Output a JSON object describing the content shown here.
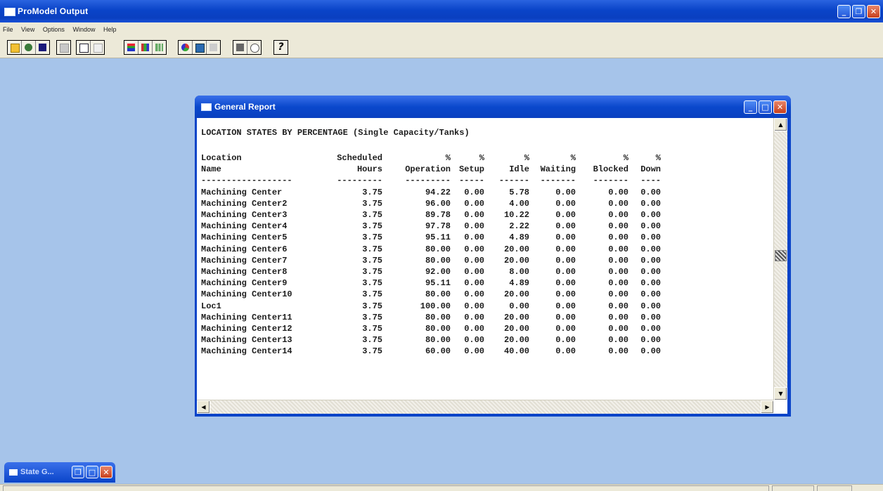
{
  "app": {
    "title": "ProModel Output"
  },
  "menu": [
    "File",
    "View",
    "Options",
    "Window",
    "Help"
  ],
  "toolbar": {
    "groups": [
      [
        "open-icon",
        "swap-icon",
        "save-icon"
      ],
      [
        "disabled-icon"
      ],
      [
        "report-icon",
        "report-disabled-icon"
      ],
      [
        "grid-icon",
        "chart-icon",
        "bar-chart-icon"
      ],
      [
        "pie-chart-icon",
        "resource-icon",
        "resource-disabled-icon"
      ],
      [
        "print-icon",
        "print-preview-icon"
      ],
      [
        "help-icon"
      ]
    ],
    "help_label": "?"
  },
  "report_window": {
    "title": "General Report",
    "report_title": "LOCATION STATES BY PERCENTAGE (Single Capacity/Tanks)",
    "headers_line1": [
      "Location",
      "Scheduled",
      "%",
      "%",
      "%",
      "%",
      "%",
      "%"
    ],
    "headers_line2": [
      "Name",
      "Hours",
      "Operation",
      "Setup",
      "Idle",
      "Waiting",
      "Blocked",
      "Down"
    ],
    "dashes": [
      "------------------",
      "---------",
      "---------",
      "-----",
      "------",
      "-------",
      "-------",
      "----"
    ],
    "rows": [
      [
        "Machining Center",
        "3.75",
        "94.22",
        "0.00",
        "5.78",
        "0.00",
        "0.00",
        "0.00"
      ],
      [
        "Machining Center2",
        "3.75",
        "96.00",
        "0.00",
        "4.00",
        "0.00",
        "0.00",
        "0.00"
      ],
      [
        "Machining Center3",
        "3.75",
        "89.78",
        "0.00",
        "10.22",
        "0.00",
        "0.00",
        "0.00"
      ],
      [
        "Machining Center4",
        "3.75",
        "97.78",
        "0.00",
        "2.22",
        "0.00",
        "0.00",
        "0.00"
      ],
      [
        "Machining Center5",
        "3.75",
        "95.11",
        "0.00",
        "4.89",
        "0.00",
        "0.00",
        "0.00"
      ],
      [
        "Machining Center6",
        "3.75",
        "80.00",
        "0.00",
        "20.00",
        "0.00",
        "0.00",
        "0.00"
      ],
      [
        "Machining Center7",
        "3.75",
        "80.00",
        "0.00",
        "20.00",
        "0.00",
        "0.00",
        "0.00"
      ],
      [
        "Machining Center8",
        "3.75",
        "92.00",
        "0.00",
        "8.00",
        "0.00",
        "0.00",
        "0.00"
      ],
      [
        "Machining Center9",
        "3.75",
        "95.11",
        "0.00",
        "4.89",
        "0.00",
        "0.00",
        "0.00"
      ],
      [
        "Machining Center10",
        "3.75",
        "80.00",
        "0.00",
        "20.00",
        "0.00",
        "0.00",
        "0.00"
      ],
      [
        "Loc1",
        "3.75",
        "100.00",
        "0.00",
        "0.00",
        "0.00",
        "0.00",
        "0.00"
      ],
      [
        "Machining Center11",
        "3.75",
        "80.00",
        "0.00",
        "20.00",
        "0.00",
        "0.00",
        "0.00"
      ],
      [
        "Machining Center12",
        "3.75",
        "80.00",
        "0.00",
        "20.00",
        "0.00",
        "0.00",
        "0.00"
      ],
      [
        "Machining Center13",
        "3.75",
        "80.00",
        "0.00",
        "20.00",
        "0.00",
        "0.00",
        "0.00"
      ],
      [
        "Machining Center14",
        "3.75",
        "60.00",
        "0.00",
        "40.00",
        "0.00",
        "0.00",
        "0.00"
      ]
    ]
  },
  "minimized_window": {
    "title": "State G..."
  },
  "caption_glyphs": {
    "minimize": "_",
    "maximize": "□",
    "restore": "❐",
    "close": "✕",
    "up": "▲",
    "down": "▼",
    "left": "◀",
    "right": "▶"
  }
}
